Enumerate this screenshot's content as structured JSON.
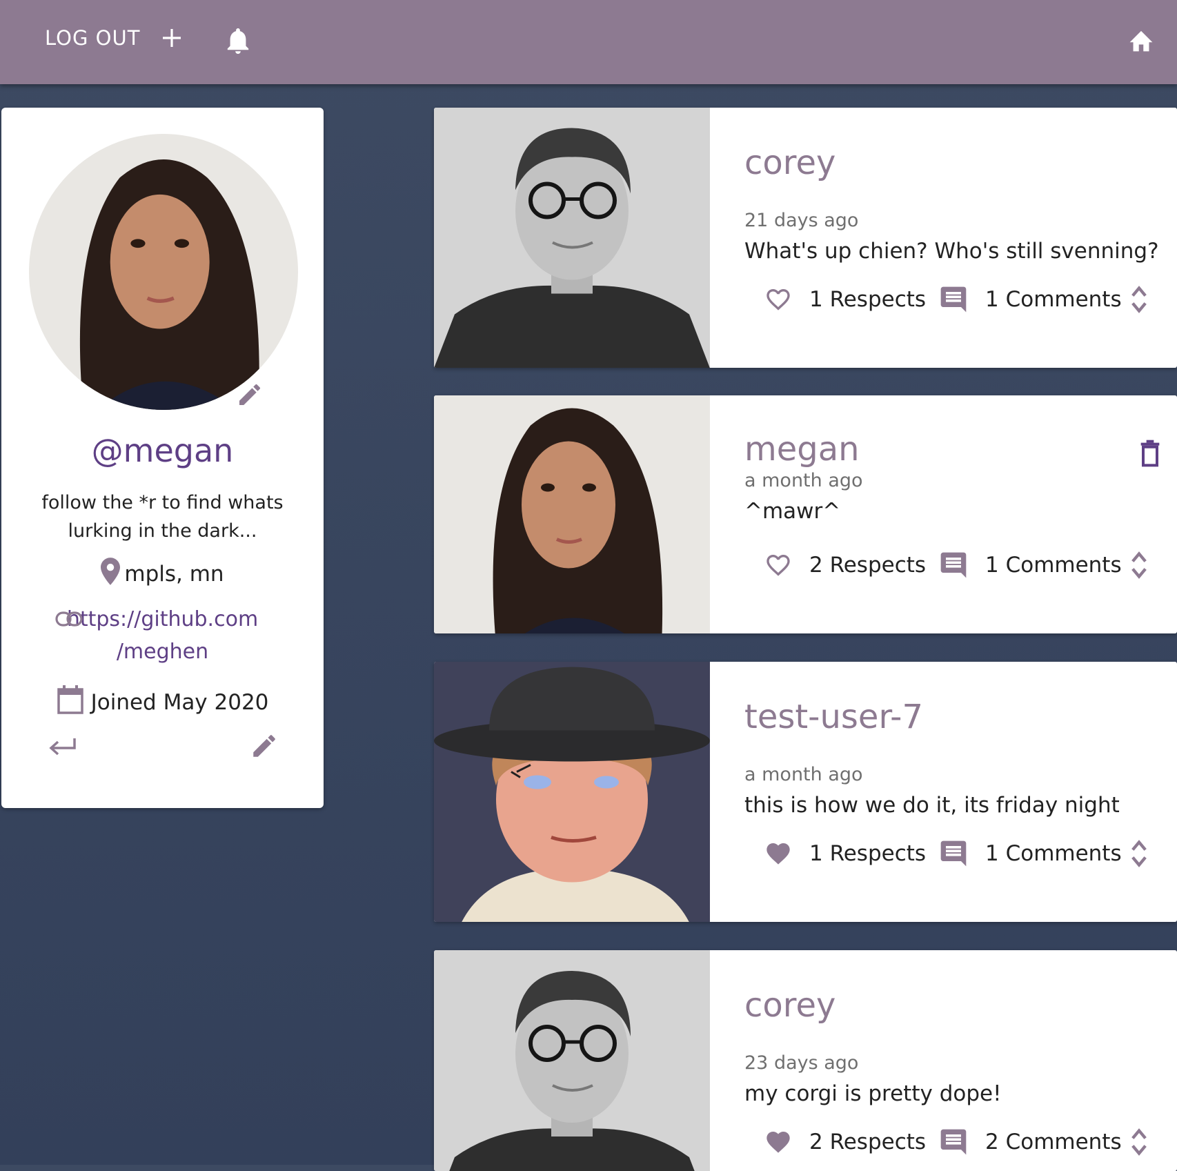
{
  "appbar": {
    "logout_label": "LOG OUT",
    "icons": [
      "plus-icon",
      "bell-icon",
      "home-icon"
    ],
    "color": "#8d7a91"
  },
  "profile": {
    "handle": "@megan",
    "bio_line1": "follow the *r to find whats",
    "bio_line2": "lurking in the dark...",
    "location": "mpls, mn",
    "link_line1": "https://github.com",
    "link_line2": "/meghen",
    "joined": "Joined May 2020"
  },
  "posts": [
    {
      "author": "corey",
      "time": "21 days ago",
      "text": "What's up chien? Who's still svenning?",
      "respects": "1 Respects",
      "comments": "1 Comments",
      "liked": false,
      "deletable": false
    },
    {
      "author": "megan",
      "time": "a month ago",
      "text": "^mawr^",
      "respects": "2 Respects",
      "comments": "1 Comments",
      "liked": false,
      "deletable": true
    },
    {
      "author": "test-user-7",
      "time": "a month ago",
      "text": "this is how we do it, its friday night",
      "respects": "1 Respects",
      "comments": "1 Comments",
      "liked": true,
      "deletable": false
    },
    {
      "author": "corey",
      "time": "23 days ago",
      "text": "my corgi is pretty dope!",
      "respects": "2 Respects",
      "comments": "2 Comments",
      "liked": true,
      "deletable": false
    }
  ],
  "colors": {
    "accent": "#8d7a91",
    "link": "#5e3f85",
    "background": "#3d4a62"
  }
}
